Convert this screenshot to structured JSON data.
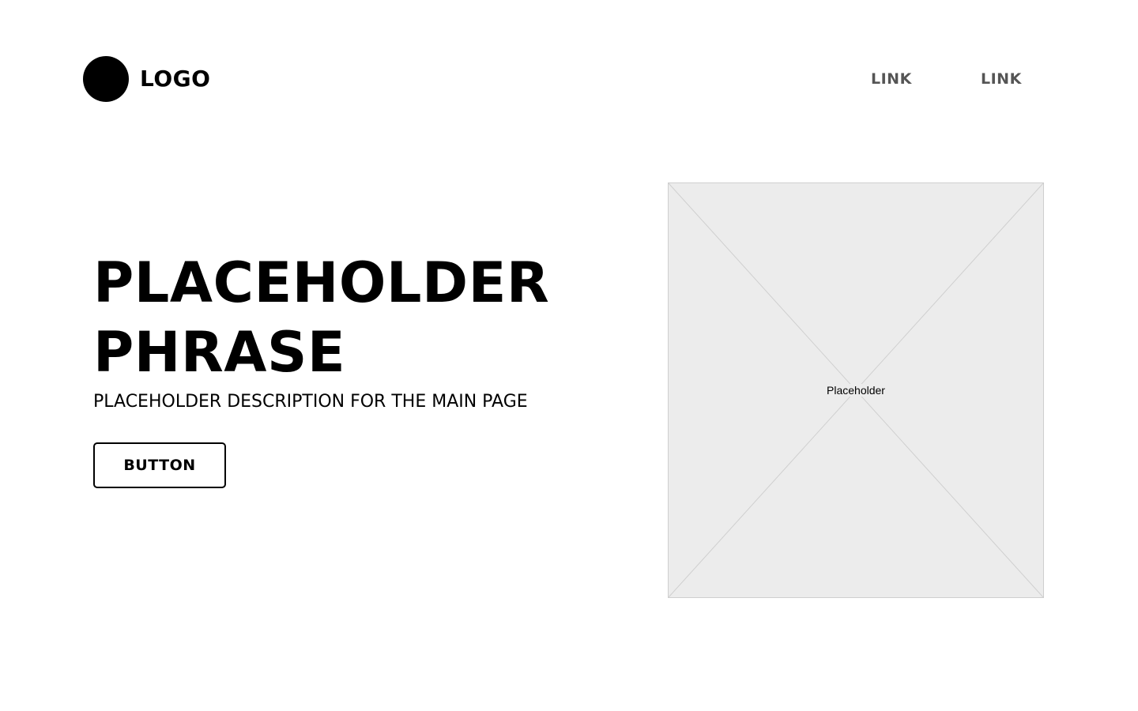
{
  "header": {
    "logo_icon": "circle-logo-icon",
    "logo_text": "LOGO",
    "nav": [
      {
        "label": "LINK"
      },
      {
        "label": "LINK"
      }
    ]
  },
  "hero": {
    "title_line1": "PLACEHOLDER",
    "title_line2": "PHRASE",
    "description": "PLACEHOLDER DESCRIPTION FOR THE MAIN PAGE",
    "button_label": "BUTTON"
  },
  "image": {
    "label": "Placeholder",
    "icon": "image-placeholder-cross-icon"
  },
  "colors": {
    "background": "#ffffff",
    "text": "#000000",
    "nav_text": "#555555",
    "placeholder_fill": "#ececec",
    "placeholder_stroke": "#cfcfcf"
  }
}
